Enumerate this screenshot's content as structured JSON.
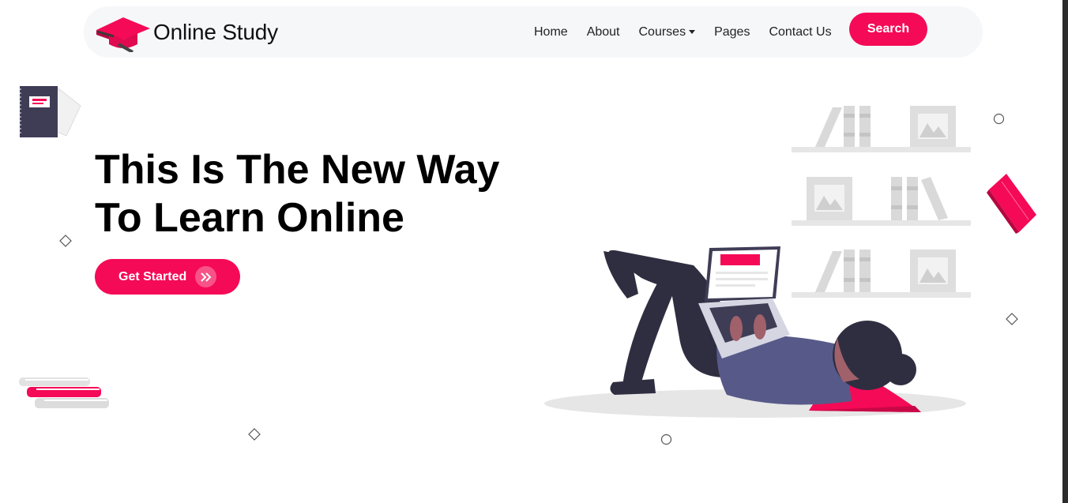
{
  "brand": {
    "name": "Online Study",
    "logo_icon": "graduation-cap-icon"
  },
  "nav": {
    "links": [
      "Home",
      "About",
      "Courses",
      "Pages",
      "Contact Us"
    ],
    "search_label": "Search"
  },
  "hero": {
    "title_line1": "This Is The New Way",
    "title_line2": "To Learn Online",
    "cta_label": "Get Started",
    "cta_icon": "double-chevron-right-icon",
    "illustration": "person-reading-laptop-illustration"
  },
  "colors": {
    "accent": "#f50a57",
    "nav_bg": "#f6f7f9",
    "dark": "#2f2e41",
    "purple": "#575a89"
  }
}
